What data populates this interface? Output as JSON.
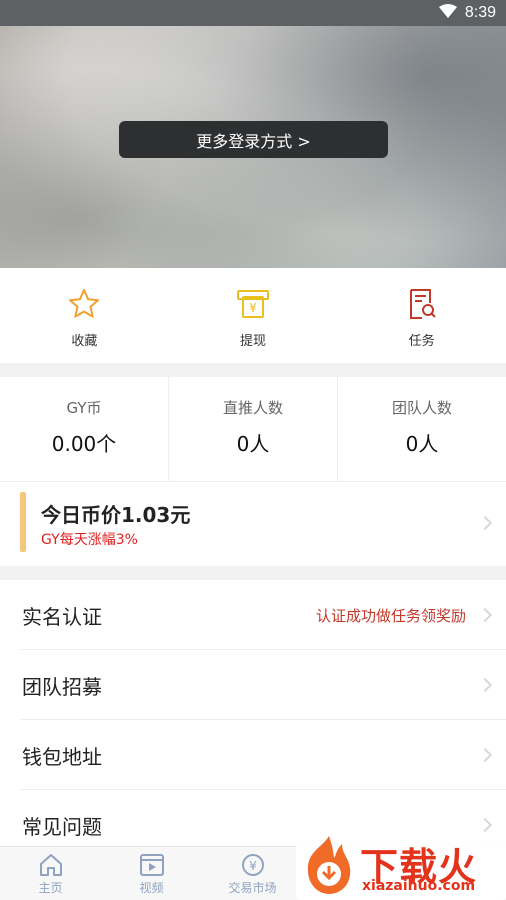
{
  "status_bar": {
    "time": "8:39"
  },
  "header": {
    "login_button": "更多登录方式 >"
  },
  "actions": [
    {
      "label": "收藏",
      "icon": "star-icon"
    },
    {
      "label": "提现",
      "icon": "withdraw-icon"
    },
    {
      "label": "任务",
      "icon": "task-icon"
    }
  ],
  "stats": [
    {
      "title": "GY币",
      "value": "0.00个"
    },
    {
      "title": "直推人数",
      "value": "0人"
    },
    {
      "title": "团队人数",
      "value": "0人"
    }
  ],
  "price": {
    "headline": "今日币价1.03元",
    "sub": "GY每天涨幅3%"
  },
  "menu": [
    {
      "label": "实名认证",
      "extra": "认证成功做任务领奖励"
    },
    {
      "label": "团队招募"
    },
    {
      "label": "钱包地址"
    },
    {
      "label": "常见问题"
    }
  ],
  "bottom_nav": [
    {
      "label": "主页",
      "icon": "home-icon"
    },
    {
      "label": "视频",
      "icon": "video-icon"
    },
    {
      "label": "交易市场",
      "icon": "market-icon"
    }
  ],
  "watermark": {
    "brand": "下载火",
    "domain": "xiazaihuo.com"
  },
  "colors": {
    "accent_yellow": "#f4c77c",
    "red": "#e02020",
    "icon_orange": "#f0a030",
    "icon_red": "#c0392b",
    "nav_blue": "#8fa3c0"
  }
}
